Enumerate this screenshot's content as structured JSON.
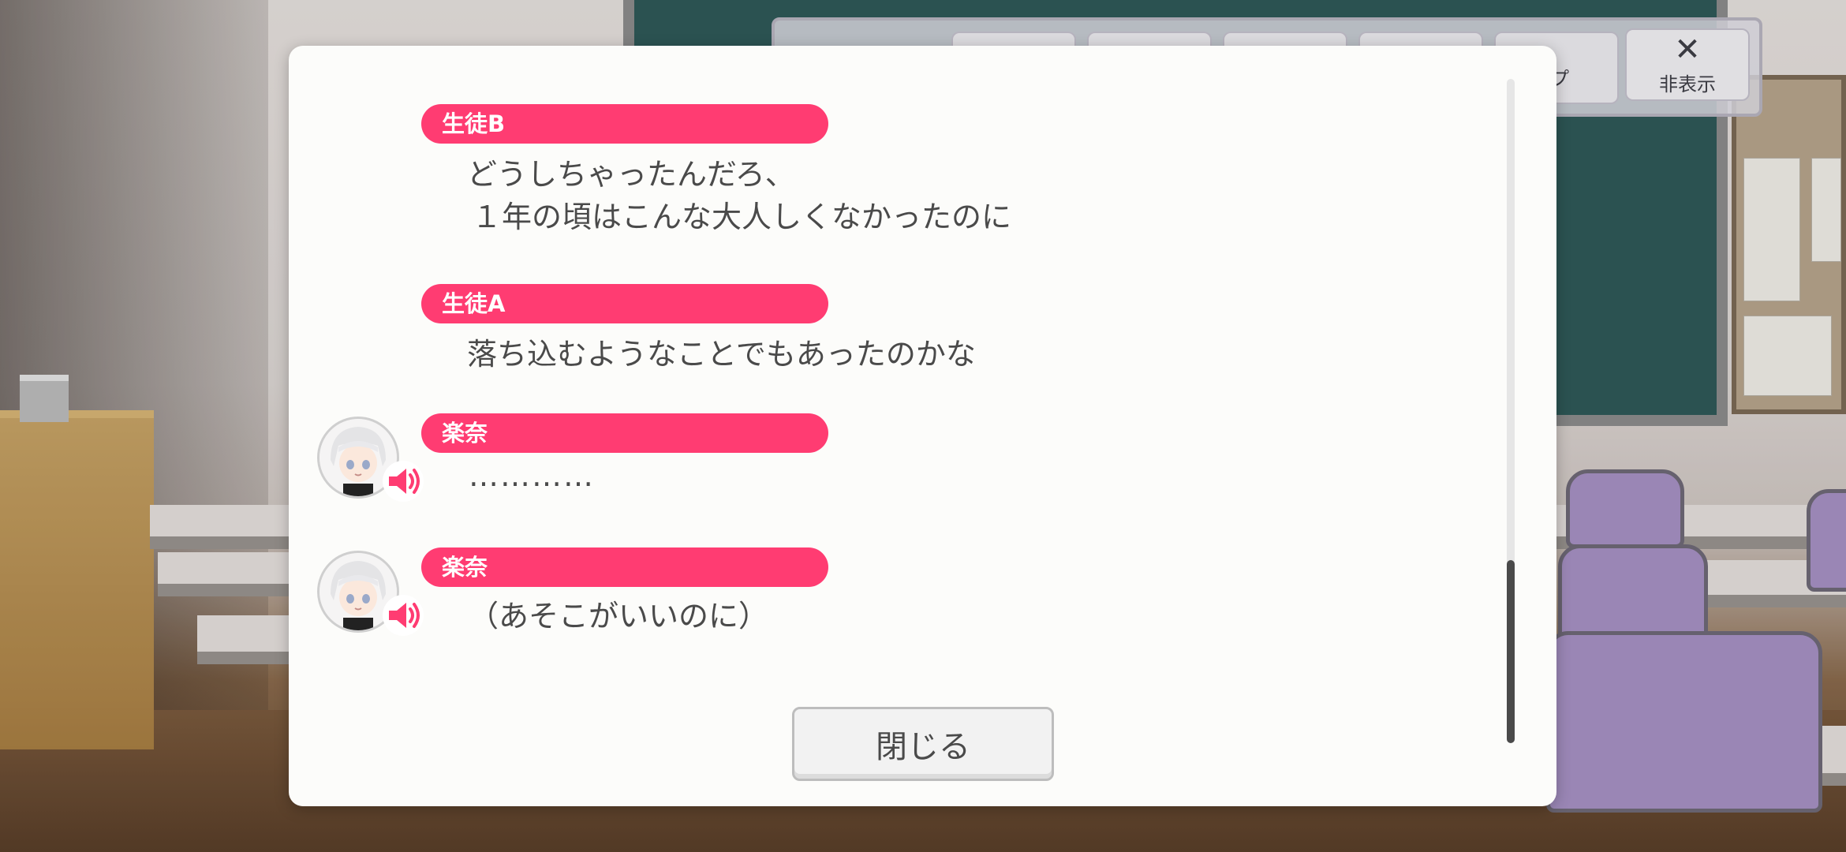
{
  "toolbar": {
    "hide_label": "非表示",
    "hide_icon": "close-x-icon",
    "log_label_fragment": "プ"
  },
  "log": {
    "entries": [
      {
        "speaker": "生徒B",
        "line1": "どうしちゃったんだろ、",
        "line2": "１年の頃はこんな大人しくなかったのに",
        "has_avatar": false
      },
      {
        "speaker": "生徒A",
        "line1": "落ち込むようなことでもあったのかな",
        "has_avatar": false
      },
      {
        "speaker": "楽奈",
        "line1": "…………",
        "has_avatar": true,
        "voice_icon": "speaker-icon"
      },
      {
        "speaker": "楽奈",
        "line1": "（あそこがいいのに）",
        "has_avatar": true,
        "voice_icon": "speaker-icon"
      }
    ]
  },
  "dialog": {
    "close_label": "閉じる"
  },
  "colors": {
    "name_tag": "#ff3c72",
    "dialog_bg": "#fcfcfa",
    "text": "#4a4a4a"
  }
}
